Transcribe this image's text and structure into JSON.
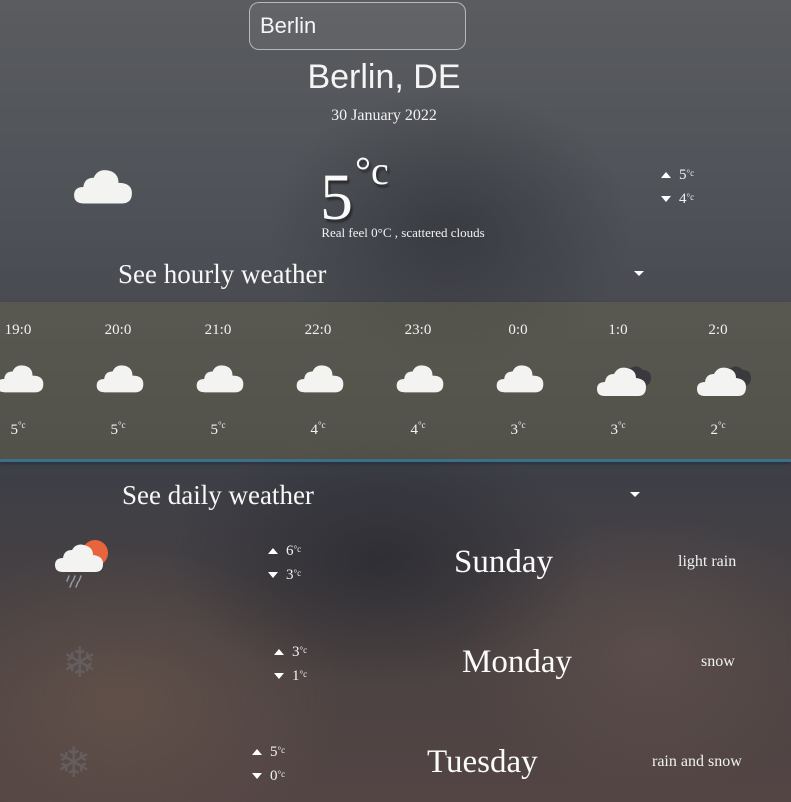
{
  "search": {
    "value": "Berlin"
  },
  "location": {
    "city": "Berlin, DE",
    "date": "30 January 2022"
  },
  "current": {
    "temp": "5",
    "unit": "°c",
    "icon": "cloud-icon",
    "real_feel": "Real feel 0°C , scattered clouds",
    "high": "5",
    "low": "4",
    "small_unit": "°c"
  },
  "hourly": {
    "title": "See hourly weather",
    "items": [
      {
        "time": "19:0",
        "temp": "5",
        "icon": "cloud-icon"
      },
      {
        "time": "20:0",
        "temp": "5",
        "icon": "cloud-icon"
      },
      {
        "time": "21:0",
        "temp": "5",
        "icon": "cloud-icon"
      },
      {
        "time": "22:0",
        "temp": "4",
        "icon": "cloud-icon"
      },
      {
        "time": "23:0",
        "temp": "4",
        "icon": "cloud-icon"
      },
      {
        "time": "0:0",
        "temp": "3",
        "icon": "cloud-icon"
      },
      {
        "time": "1:0",
        "temp": "3",
        "icon": "broken-clouds-icon"
      },
      {
        "time": "2:0",
        "temp": "2",
        "icon": "broken-clouds-icon"
      }
    ]
  },
  "daily": {
    "title": "See daily weather",
    "items": [
      {
        "day": "Sunday",
        "high": "6",
        "low": "3",
        "desc": "light rain",
        "icon": "sun-rain-cloud-icon"
      },
      {
        "day": "Monday",
        "high": "3",
        "low": "1",
        "desc": "snow",
        "icon": "snowflake-icon"
      },
      {
        "day": "Tuesday",
        "high": "5",
        "low": "0",
        "desc": "rain and snow",
        "icon": "snowflake-icon"
      }
    ]
  },
  "colors": {
    "accent_line": "#3e6f86",
    "sun": "#e8643c",
    "cloud": "#f2f2f2"
  }
}
